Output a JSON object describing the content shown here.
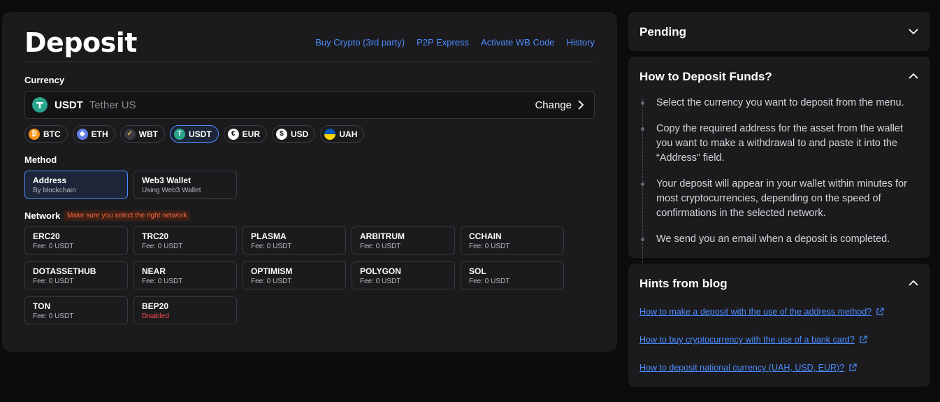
{
  "deposit": {
    "title": "Deposit",
    "links": [
      "Buy Crypto (3rd party)",
      "P2P Express",
      "Activate WB Code",
      "History"
    ],
    "currency_label": "Currency",
    "selected_currency": {
      "code": "USDT",
      "name": "Tether US",
      "change_label": "Change"
    },
    "chips": [
      {
        "code": "BTC",
        "color": "#f7931a",
        "glyph": "₿",
        "icon": "bitcoin-icon"
      },
      {
        "code": "ETH",
        "color": "#627eea",
        "glyph": "◆",
        "icon": "ethereum-icon"
      },
      {
        "code": "WBT",
        "color": "#3a3a40",
        "glyph": "✓",
        "icon": "whitebit-icon"
      },
      {
        "code": "USDT",
        "color": "#2aa58d",
        "glyph": "T",
        "icon": "tether-icon",
        "active": true
      },
      {
        "code": "EUR",
        "color": "#ffffff",
        "glyph": "€",
        "icon": "euro-icon"
      },
      {
        "code": "USD",
        "color": "#ffffff",
        "glyph": "$",
        "icon": "dollar-icon"
      },
      {
        "code": "UAH",
        "color": "#0057b7",
        "glyph": "",
        "icon": "ukraine-flag-icon"
      }
    ],
    "method_label": "Method",
    "methods": [
      {
        "title": "Address",
        "sub": "By blockchain"
      },
      {
        "title": "Web3 Wallet",
        "sub": "Using Web3 Wallet"
      }
    ],
    "network_label": "Network",
    "network_warning": "Make sure you select the right network",
    "networks": [
      {
        "name": "ERC20",
        "fee": "Fee: 0 USDT"
      },
      {
        "name": "TRC20",
        "fee": "Fee: 0 USDT"
      },
      {
        "name": "PLASMA",
        "fee": "Fee: 0 USDT"
      },
      {
        "name": "ARBITRUM",
        "fee": "Fee: 0 USDT"
      },
      {
        "name": "CCHAIN",
        "fee": "Fee: 0 USDT"
      },
      {
        "name": "DOTASSETHUB",
        "fee": "Fee: 0 USDT"
      },
      {
        "name": "NEAR",
        "fee": "Fee: 0 USDT"
      },
      {
        "name": "OPTIMISM",
        "fee": "Fee: 0 USDT"
      },
      {
        "name": "POLYGON",
        "fee": "Fee: 0 USDT"
      },
      {
        "name": "SOL",
        "fee": "Fee: 0 USDT"
      },
      {
        "name": "TON",
        "fee": "Fee: 0 USDT"
      },
      {
        "name": "BEP20",
        "fee": "Disabled",
        "disabled": true
      }
    ]
  },
  "pending": {
    "title": "Pending"
  },
  "how_to": {
    "title": "How to Deposit Funds?",
    "steps": [
      "Select the currency you want to deposit from the menu.",
      "Copy the required address for the asset from the wallet you want to make a withdrawal to and paste it into the “Address” field.",
      "Your deposit will appear in your wallet within minutes for most cryptocurrencies, depending on the speed of confirmations in the selected network.",
      "We send you an email when a deposit is completed."
    ]
  },
  "blog": {
    "title": "Hints from blog",
    "links": [
      "How to make a deposit with the use of the address method?",
      "How to buy cryptocurrency with the use of a bank card?",
      "How to deposit national currency (UAH, USD, EUR)?"
    ]
  },
  "colors": {
    "accent": "#4c8dff",
    "warning": "#ff6a3d",
    "error": "#ff4b4b"
  }
}
